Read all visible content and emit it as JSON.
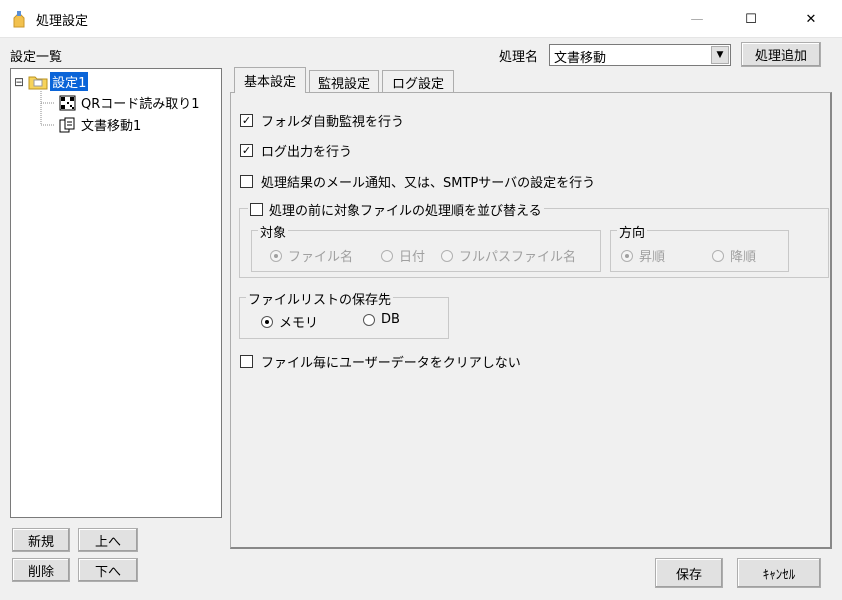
{
  "window": {
    "title": "処理設定",
    "minimize_glyph": "—",
    "maximize_glyph": "☐",
    "close_glyph": "✕"
  },
  "sidebar": {
    "header": "設定一覧",
    "tree": {
      "collapse_glyph": "⊟",
      "root": {
        "label": "設定1",
        "icon": "folder-icon",
        "selected": true
      },
      "children": [
        {
          "label": "QRコード読み取り1",
          "icon": "qr-code-icon"
        },
        {
          "label": "文書移動1",
          "icon": "document-move-icon"
        }
      ]
    },
    "buttons": {
      "new": "新規",
      "up": "上へ",
      "delete": "削除",
      "down": "下へ"
    }
  },
  "process": {
    "label": "処理名",
    "selected_value": "文書移動",
    "add_button": "処理追加",
    "dropdown_glyph": "▼"
  },
  "tabs": [
    {
      "label": "基本設定",
      "active": true
    },
    {
      "label": "監視設定",
      "active": false
    },
    {
      "label": "ログ設定",
      "active": false
    }
  ],
  "basic": {
    "folder_watch": {
      "label": "フォルダ自動監視を行う",
      "checked": true
    },
    "log_output": {
      "label": "ログ出力を行う",
      "checked": true
    },
    "mail_notify": {
      "label": "処理結果のメール通知、又は、SMTPサーバの設定を行う",
      "checked": false
    },
    "sort_group": {
      "label": "処理の前に対象ファイルの処理順を並び替える",
      "checked": false,
      "target": {
        "label": "対象",
        "options": [
          "ファイル名",
          "日付",
          "フルパスファイル名"
        ],
        "selected": "ファイル名"
      },
      "direction": {
        "label": "方向",
        "options": [
          "昇順",
          "降順"
        ],
        "selected": "昇順"
      }
    },
    "filelist": {
      "label": "ファイルリストの保存先",
      "options": [
        "メモリ",
        "DB"
      ],
      "selected": "メモリ"
    },
    "no_clear_userdata": {
      "label": "ファイル毎にユーザーデータをクリアしない",
      "checked": false
    }
  },
  "footer": {
    "save": "保存",
    "cancel": "ｷｬﾝｾﾙ"
  },
  "colors": {
    "selection": "#0a64d8",
    "background": "#f0f0f0",
    "disabled_text": "#a0a0a0"
  }
}
